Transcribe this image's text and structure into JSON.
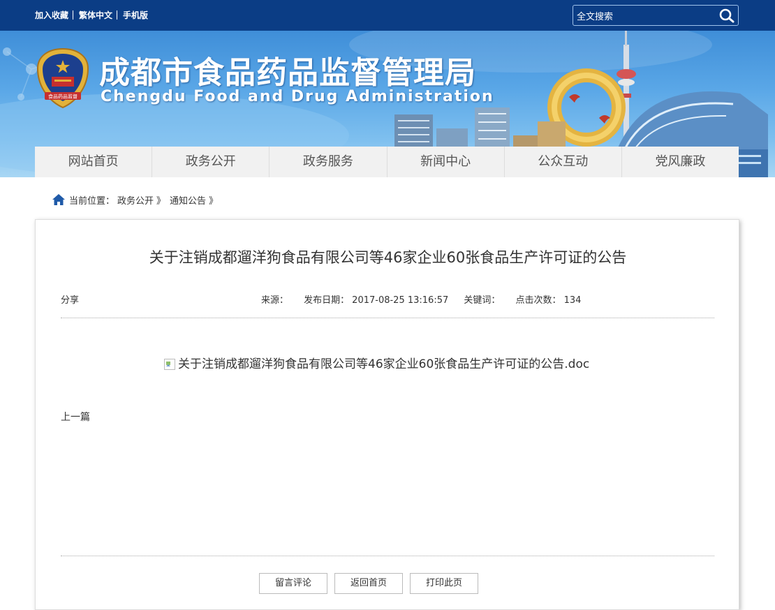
{
  "top_links": [
    "加入收藏",
    "繁体中文",
    "手机版"
  ],
  "search": {
    "value": "全文搜索",
    "icon": "search-icon"
  },
  "banner": {
    "title_cn": "成都市食品药品监督管理局",
    "title_en": "Chengdu Food and Drug Administration",
    "emblem_text": "食品药品监督"
  },
  "nav": {
    "items": [
      "网站首页",
      "政务公开",
      "政务服务",
      "新闻中心",
      "公众互动",
      "党风廉政"
    ]
  },
  "breadcrumb": {
    "label": "当前位置：",
    "items": [
      "政务公开",
      "通知公告"
    ],
    "separator": "》"
  },
  "article": {
    "title": "关于注销成都遛洋狗食品有限公司等46家企业60张食品生产许可证的公告",
    "share": "分享",
    "source_label": "来源：",
    "date_label": "发布日期：",
    "date": "2017-08-25 13:16:57",
    "keywords_label": "关键词：",
    "clicks_label": "点击次数：",
    "clicks": "134",
    "attachment": "关于注销成都遛洋狗食品有限公司等46家企业60张食品生产许可证的公告.doc",
    "prev_label": "上一篇"
  },
  "buttons": {
    "comment": "留言评论",
    "home": "返回首页",
    "print": "打印此页"
  },
  "colors": {
    "topbar": "#0b3d85",
    "nav_bg": "#f1f1f1"
  }
}
